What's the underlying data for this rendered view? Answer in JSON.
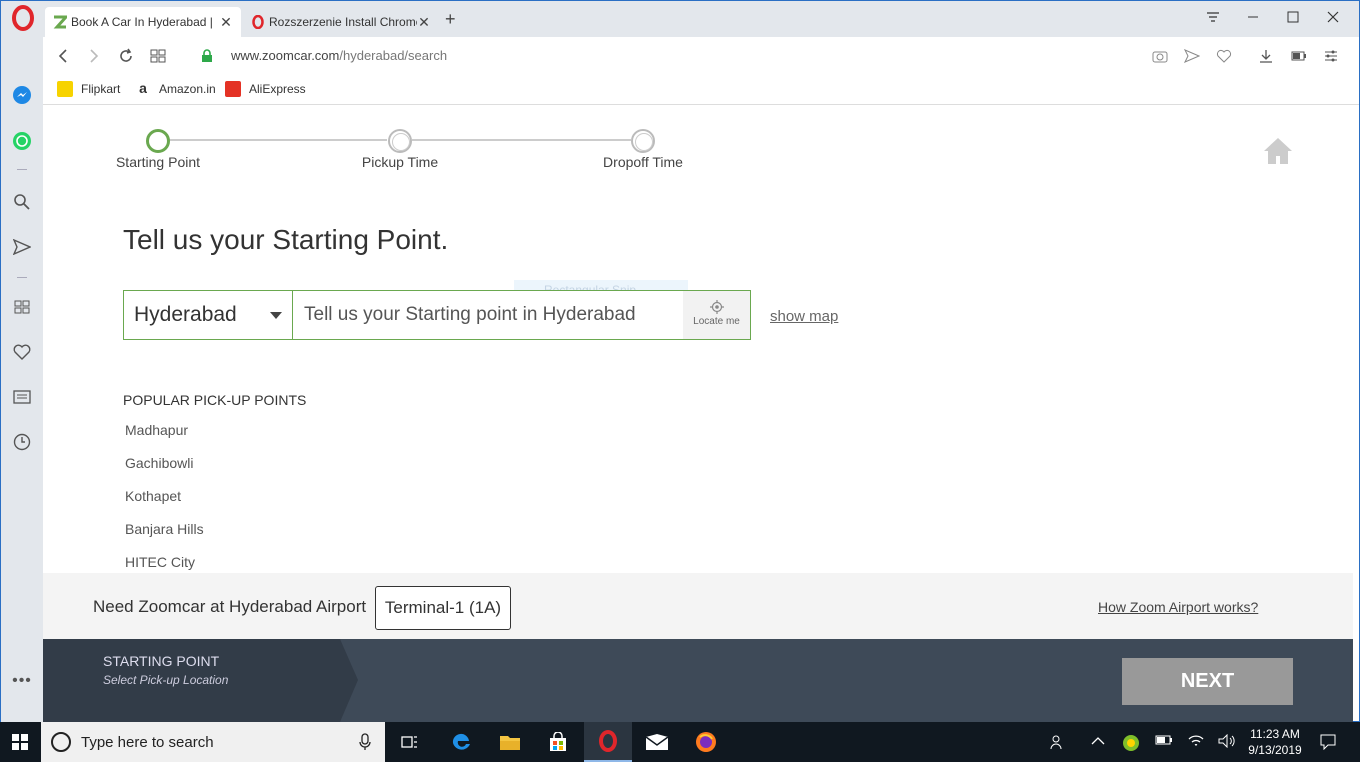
{
  "browser": {
    "tabs": [
      {
        "title": "Book A Car In Hyderabad |",
        "active": true
      },
      {
        "title": "Rozszerzenie Install Chrome",
        "active": false
      }
    ],
    "url_host": "www.zoomcar.com",
    "url_path": "/hyderabad/search",
    "bookmarks": [
      {
        "label": "Flipkart",
        "color": "#f7d300"
      },
      {
        "label": "Amazon.in",
        "color": "#222222"
      },
      {
        "label": "AliExpress",
        "color": "#e43225"
      }
    ]
  },
  "steps": [
    {
      "label": "Starting Point",
      "active": true
    },
    {
      "label": "Pickup Time",
      "active": false
    },
    {
      "label": "Dropoff Time",
      "active": false
    }
  ],
  "main": {
    "heading": "Tell us your Starting Point.",
    "city": "Hyderabad",
    "search_placeholder": "Tell us your Starting point in Hyderabad",
    "locate_label": "Locate me",
    "show_map": "show map",
    "ghost_text": "Rectangular Snip",
    "popular_title": "POPULAR PICK-UP POINTS",
    "popular_points": [
      "Madhapur",
      "Gachibowli",
      "Kothapet",
      "Banjara Hills",
      "HITEC City"
    ]
  },
  "airport": {
    "text": "Need Zoomcar at Hyderabad Airport",
    "terminal": "Terminal-1 (1A)",
    "how_link": "How Zoom Airport works?"
  },
  "footer": {
    "step_title": "STARTING POINT",
    "step_sub": "Select Pick-up Location",
    "next": "NEXT"
  },
  "taskbar": {
    "search_placeholder": "Type here to search",
    "time": "11:23 AM",
    "date": "9/13/2019"
  },
  "colors": {
    "accent_green": "#6aa84f",
    "footer_bg": "#3e4a58",
    "opera_red": "#e0262b"
  }
}
